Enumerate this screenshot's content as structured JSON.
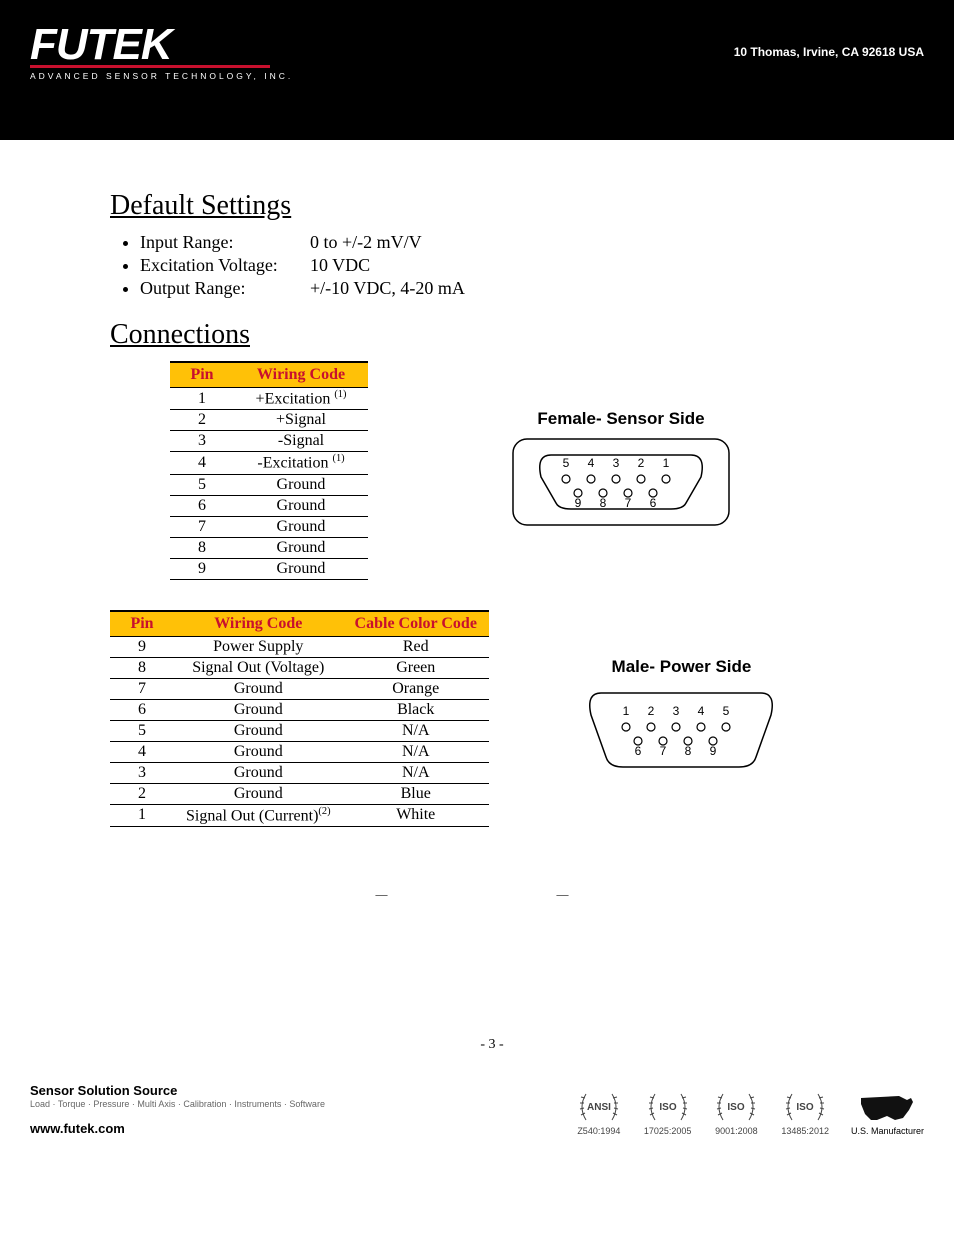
{
  "header": {
    "logo_main": "FUTEK",
    "logo_sub": "ADVANCED SENSOR TECHNOLOGY, INC.",
    "address": "10 Thomas, Irvine, CA 92618 USA"
  },
  "sections": {
    "default_settings_title": "Default Settings",
    "connections_title": "Connections"
  },
  "default_settings": [
    {
      "label": "Input Range:",
      "value": "0 to +/-2 mV/V"
    },
    {
      "label": "Excitation Voltage:",
      "value": "10 VDC"
    },
    {
      "label": "Output Range:",
      "value": "+/-10 VDC, 4-20 mA"
    }
  ],
  "table1": {
    "headers": {
      "pin": "Pin",
      "wiring": "Wiring Code"
    },
    "rows": [
      {
        "pin": "1",
        "wiring": "+Excitation",
        "sup": "(1)"
      },
      {
        "pin": "2",
        "wiring": "+Signal",
        "sup": ""
      },
      {
        "pin": "3",
        "wiring": "-Signal",
        "sup": ""
      },
      {
        "pin": "4",
        "wiring": "-Excitation",
        "sup": "(1)"
      },
      {
        "pin": "5",
        "wiring": "Ground",
        "sup": ""
      },
      {
        "pin": "6",
        "wiring": "Ground",
        "sup": ""
      },
      {
        "pin": "7",
        "wiring": "Ground",
        "sup": ""
      },
      {
        "pin": "8",
        "wiring": "Ground",
        "sup": ""
      },
      {
        "pin": "9",
        "wiring": "Ground",
        "sup": ""
      }
    ]
  },
  "table2": {
    "headers": {
      "pin": "Pin",
      "wiring": "Wiring Code",
      "color": "Cable Color Code"
    },
    "rows": [
      {
        "pin": "9",
        "wiring": "Power Supply",
        "sup": "",
        "color": "Red"
      },
      {
        "pin": "8",
        "wiring": "Signal Out (Voltage)",
        "sup": "",
        "color": "Green"
      },
      {
        "pin": "7",
        "wiring": "Ground",
        "sup": "",
        "color": "Orange"
      },
      {
        "pin": "6",
        "wiring": "Ground",
        "sup": "",
        "color": "Black"
      },
      {
        "pin": "5",
        "wiring": "Ground",
        "sup": "",
        "color": "N/A"
      },
      {
        "pin": "4",
        "wiring": "Ground",
        "sup": "",
        "color": "N/A"
      },
      {
        "pin": "3",
        "wiring": "Ground",
        "sup": "",
        "color": "N/A"
      },
      {
        "pin": "2",
        "wiring": "Ground",
        "sup": "",
        "color": "Blue"
      },
      {
        "pin": "1",
        "wiring": "Signal Out (Current)",
        "sup": "(2)",
        "color": "White"
      }
    ]
  },
  "connectors": {
    "female": {
      "title": "Female- Sensor Side",
      "top_row": [
        "5",
        "4",
        "3",
        "2",
        "1"
      ],
      "bottom_row": [
        "9",
        "8",
        "7",
        "6"
      ]
    },
    "male": {
      "title": "Male- Power Side",
      "top_row": [
        "1",
        "2",
        "3",
        "4",
        "5"
      ],
      "bottom_row": [
        "6",
        "7",
        "8",
        "9"
      ]
    }
  },
  "page": {
    "number": "- 3 -"
  },
  "footer": {
    "line1": "Sensor Solution Source",
    "line2": "Load · Torque · Pressure · Multi Axis · Calibration · Instruments · Software",
    "url": "www.futek.com",
    "certs": [
      {
        "top": "ANSI",
        "bottom": "Z540:1994"
      },
      {
        "top": "ISO",
        "bottom": "17025:2005"
      },
      {
        "top": "ISO",
        "bottom": "9001:2008"
      },
      {
        "top": "ISO",
        "bottom": "13485:2012"
      }
    ],
    "usmfg": "U.S. Manufacturer"
  }
}
